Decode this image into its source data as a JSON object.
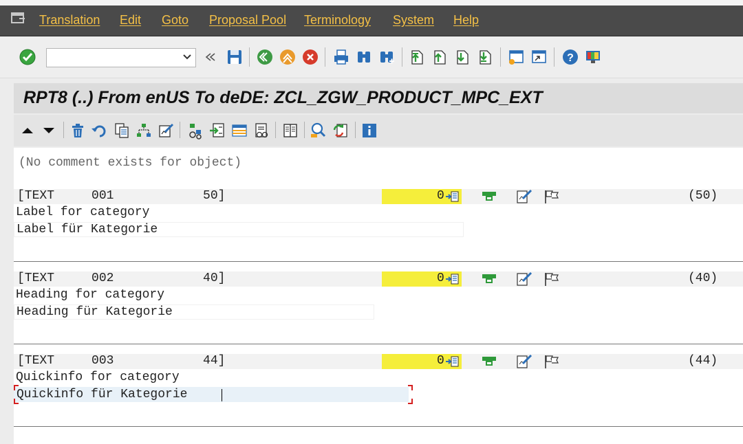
{
  "menu": {
    "items": [
      "Translation",
      "Edit",
      "Goto",
      "Proposal Pool",
      "Terminology",
      "System",
      "Help"
    ]
  },
  "toolbar": {
    "command_value": "",
    "icons": [
      "enter-icon",
      "back-nav-icon",
      "save-icon",
      "back-icon",
      "exit-icon",
      "cancel-icon",
      "print-icon",
      "find-icon",
      "find-next-icon",
      "first-page-icon",
      "previous-page-icon",
      "next-page-icon",
      "last-page-icon",
      "create-session-icon",
      "shortcut-icon",
      "help-icon",
      "customize-layout-icon"
    ]
  },
  "title": "RPT8 (..) From enUS To deDE: ZCL_ZGW_PRODUCT_MPC_EXT",
  "comment": "(No comment exists for object)",
  "entries": [
    {
      "header_label": "[TEXT     001            50]",
      "count": "0",
      "length": "(50)",
      "source": "Label for category",
      "target": "Label für Kategorie"
    },
    {
      "header_label": "[TEXT     002            40]",
      "count": "0",
      "length": "(40)",
      "source": "Heading for category",
      "target": "Heading für Kategorie"
    },
    {
      "header_label": "[TEXT     003            44]",
      "count": "0",
      "length": "(44)",
      "source": "Quickinfo for category",
      "target": "Quickinfo für Kategorie"
    }
  ],
  "colors": {
    "menubar": "#4a4a4a",
    "menu_text": "#f4c046",
    "highlight": "#f5ee3b",
    "focus_bracket": "#d42020"
  }
}
